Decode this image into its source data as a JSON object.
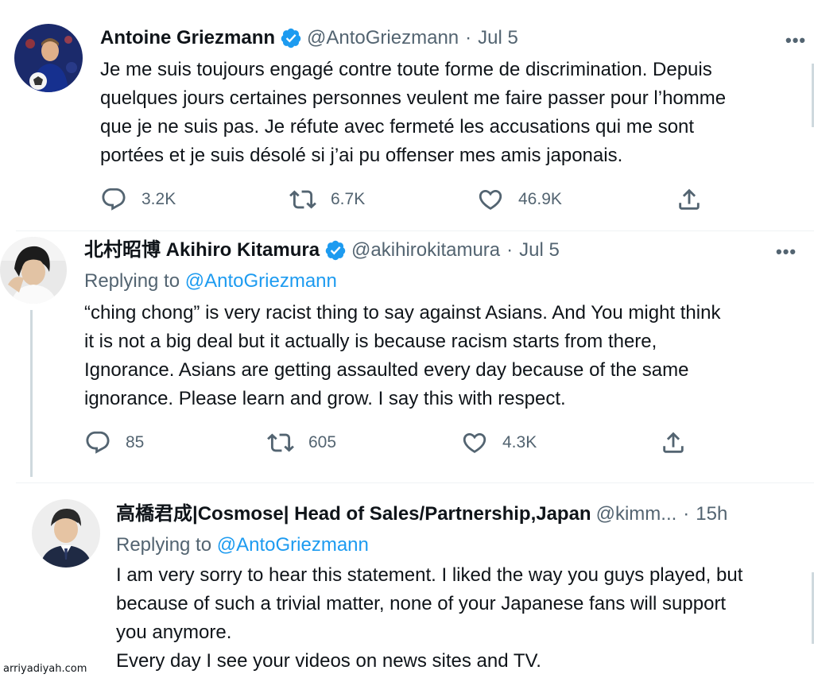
{
  "tweets": [
    {
      "name": "Antoine Griezmann",
      "handle": "@AntoGriezmann",
      "dot": "·",
      "time": "Jul 5",
      "verified": true,
      "lines": [
        "Je me suis toujours engagé contre toute forme de discrimination. Depuis",
        "quelques jours certaines personnes veulent me faire passer pour l’homme",
        "que je ne suis pas. Je réfute avec fermeté les accusations qui me sont",
        "portées et je suis désolé si j’ai pu offenser mes amis japonais."
      ],
      "reply_count": "3.2K",
      "retweet_count": "6.7K",
      "like_count": "46.9K"
    },
    {
      "name": "北村昭博 Akihiro Kitamura",
      "handle": "@akihirokitamura",
      "dot": "·",
      "time": "Jul 5",
      "verified": true,
      "replying_prefix": "Replying to ",
      "replying_to": "@AntoGriezmann",
      "lines": [
        "“ching chong” is very racist thing to say against Asians. And You might think",
        "it is not a big deal but it actually is because racism starts from there,",
        "Ignorance. Asians are getting assaulted every day because of the same",
        "ignorance. Please learn and grow. I say this with respect."
      ],
      "reply_count": "85",
      "retweet_count": "605",
      "like_count": "4.3K"
    },
    {
      "name": "高橋君成|Cosmose| Head of Sales/Partnership,Japan",
      "handle": "@kimm...",
      "dot": "·",
      "time": "15h",
      "verified": false,
      "replying_prefix": "Replying to ",
      "replying_to": "@AntoGriezmann",
      "lines": [
        "I am very sorry to hear this statement. I liked the way you guys played, but",
        "because of such a trivial matter, none of your Japanese fans will support",
        "you anymore.",
        "Every day I see your videos on news sites and TV."
      ]
    }
  ],
  "more_label": "•••",
  "watermark": "arriyadiyah.com",
  "colors": {
    "accent": "#1d9bf0",
    "secondary_text": "#536471",
    "primary_text": "#0f1419"
  }
}
